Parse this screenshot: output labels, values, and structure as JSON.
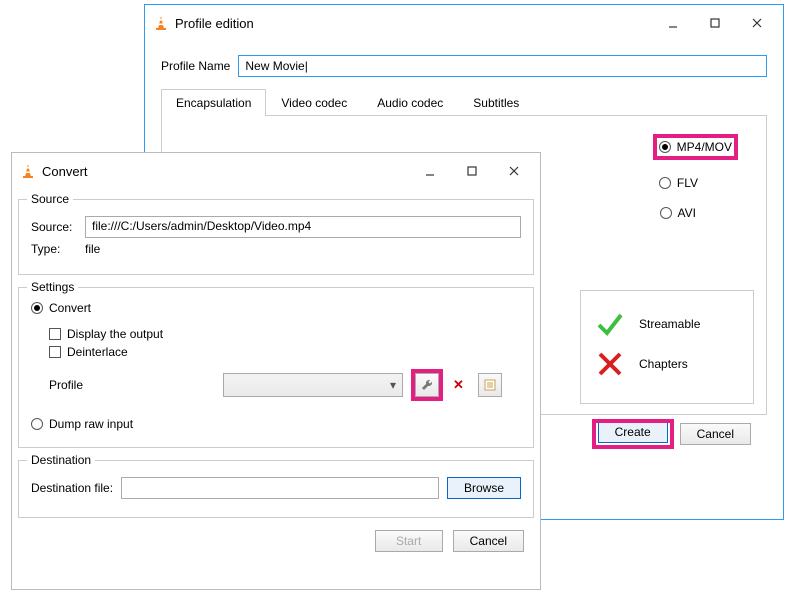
{
  "profile_window": {
    "title": "Profile edition",
    "name_label": "Profile Name",
    "name_value": "New Movie",
    "tabs": {
      "encapsulation": "Encapsulation",
      "video": "Video codec",
      "audio": "Audio codec",
      "subtitles": "Subtitles"
    },
    "radios": {
      "mp4": "MP4/MOV",
      "flv": "FLV",
      "avi": "AVI"
    },
    "status": {
      "streamable": "Streamable",
      "chapters": "Chapters"
    },
    "buttons": {
      "create": "Create",
      "cancel": "Cancel"
    }
  },
  "convert_window": {
    "title": "Convert",
    "source": {
      "legend": "Source",
      "source_label": "Source:",
      "source_value": "file:///C:/Users/admin/Desktop/Video.mp4",
      "type_label": "Type:",
      "type_value": "file"
    },
    "settings": {
      "legend": "Settings",
      "convert": "Convert",
      "display_output": "Display the output",
      "deinterlace": "Deinterlace",
      "profile_label": "Profile",
      "dump_raw": "Dump raw input"
    },
    "destination": {
      "legend": "Destination",
      "label": "Destination file:"
    },
    "buttons": {
      "browse": "Browse",
      "start": "Start",
      "cancel": "Cancel"
    }
  }
}
